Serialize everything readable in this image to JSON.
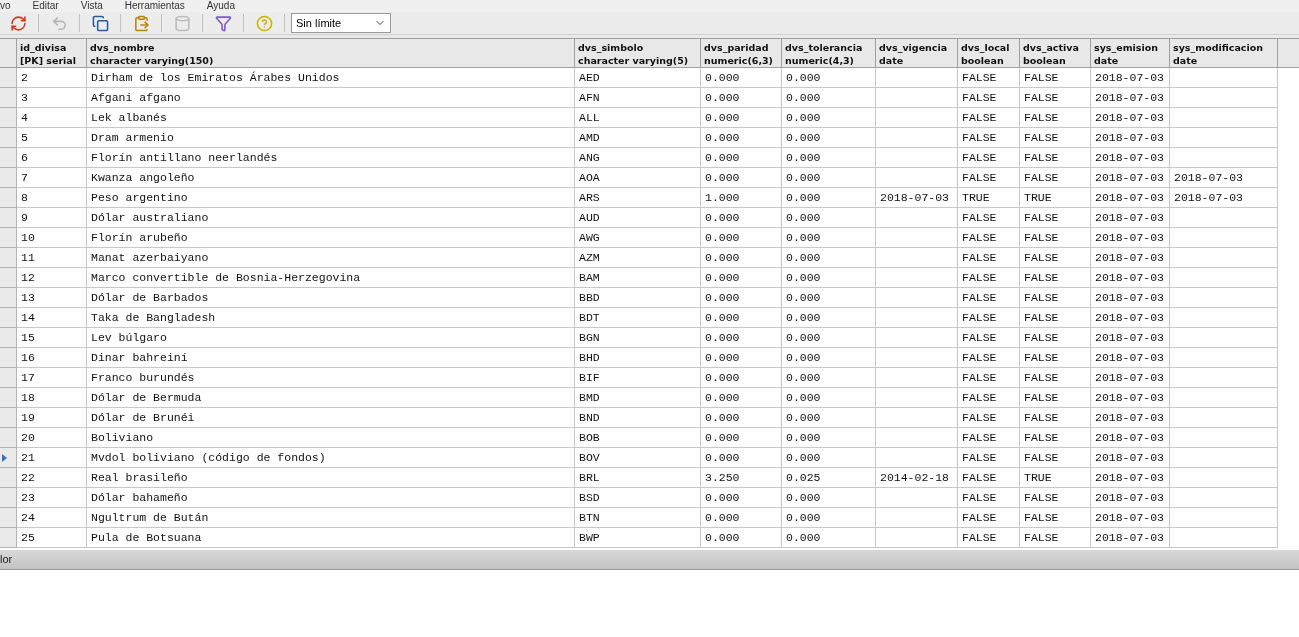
{
  "menu": [
    {
      "label": "vo"
    },
    {
      "label": "Editar"
    },
    {
      "label": "Vista"
    },
    {
      "label": "Herramientas"
    },
    {
      "label": "Ayuda"
    }
  ],
  "toolbar": {
    "buttons": [
      {
        "kind": "refresh",
        "disabled": false
      },
      {
        "kind": "undo",
        "disabled": true
      },
      {
        "kind": "copy",
        "disabled": false
      },
      {
        "kind": "paste",
        "disabled": false
      },
      {
        "kind": "delete",
        "disabled": true
      },
      {
        "kind": "filter",
        "disabled": false
      },
      {
        "kind": "help",
        "disabled": false
      }
    ],
    "limit": {
      "value": "Sin límite"
    }
  },
  "table": {
    "columns": [
      {
        "name": "id_divisa",
        "type": "[PK] serial"
      },
      {
        "name": "dvs_nombre",
        "type": "character varying(150)"
      },
      {
        "name": "dvs_simbolo",
        "type": "character varying(5)"
      },
      {
        "name": "dvs_paridad",
        "type": "numeric(6,3)"
      },
      {
        "name": "dvs_tolerancia",
        "type": "numeric(4,3)"
      },
      {
        "name": "dvs_vigencia",
        "type": "date"
      },
      {
        "name": "dvs_local",
        "type": "boolean"
      },
      {
        "name": "dvs_activa",
        "type": "boolean"
      },
      {
        "name": "sys_emision",
        "type": "date"
      },
      {
        "name": "sys_modificacion",
        "type": "date"
      }
    ],
    "rows": [
      {
        "current": false,
        "cells": [
          "2",
          "Dirham de los Emiratos Árabes Unidos",
          "AED",
          "0.000",
          "0.000",
          null,
          "FALSE",
          "FALSE",
          "2018-07-03",
          null
        ]
      },
      {
        "current": false,
        "cells": [
          "3",
          "Afgani afgano",
          "AFN",
          "0.000",
          "0.000",
          null,
          "FALSE",
          "FALSE",
          "2018-07-03",
          null
        ]
      },
      {
        "current": false,
        "cells": [
          "4",
          "Lek albanés",
          "ALL",
          "0.000",
          "0.000",
          null,
          "FALSE",
          "FALSE",
          "2018-07-03",
          null
        ]
      },
      {
        "current": false,
        "cells": [
          "5",
          "Dram armenio",
          "AMD",
          "0.000",
          "0.000",
          null,
          "FALSE",
          "FALSE",
          "2018-07-03",
          null
        ]
      },
      {
        "current": false,
        "cells": [
          "6",
          "Florín antillano neerlandés",
          "ANG",
          "0.000",
          "0.000",
          null,
          "FALSE",
          "FALSE",
          "2018-07-03",
          null
        ]
      },
      {
        "current": false,
        "cells": [
          "7",
          "Kwanza angoleño",
          "AOA",
          "0.000",
          "0.000",
          null,
          "FALSE",
          "FALSE",
          "2018-07-03",
          "2018-07-03"
        ]
      },
      {
        "current": false,
        "cells": [
          "8",
          "Peso argentino",
          "ARS",
          "1.000",
          "0.000",
          "2018-07-03",
          "TRUE",
          "TRUE",
          "2018-07-03",
          "2018-07-03"
        ]
      },
      {
        "current": false,
        "cells": [
          "9",
          "Dólar australiano",
          "AUD",
          "0.000",
          "0.000",
          null,
          "FALSE",
          "FALSE",
          "2018-07-03",
          null
        ]
      },
      {
        "current": false,
        "cells": [
          "10",
          "Florín arubeño",
          "AWG",
          "0.000",
          "0.000",
          null,
          "FALSE",
          "FALSE",
          "2018-07-03",
          null
        ]
      },
      {
        "current": false,
        "cells": [
          "11",
          "Manat azerbaiyano",
          "AZM",
          "0.000",
          "0.000",
          null,
          "FALSE",
          "FALSE",
          "2018-07-03",
          null
        ]
      },
      {
        "current": false,
        "cells": [
          "12",
          "Marco convertible de Bosnia-Herzegovina",
          "BAM",
          "0.000",
          "0.000",
          null,
          "FALSE",
          "FALSE",
          "2018-07-03",
          null
        ]
      },
      {
        "current": false,
        "cells": [
          "13",
          "Dólar de Barbados",
          "BBD",
          "0.000",
          "0.000",
          null,
          "FALSE",
          "FALSE",
          "2018-07-03",
          null
        ]
      },
      {
        "current": false,
        "cells": [
          "14",
          "Taka de Bangladesh",
          "BDT",
          "0.000",
          "0.000",
          null,
          "FALSE",
          "FALSE",
          "2018-07-03",
          null
        ]
      },
      {
        "current": false,
        "cells": [
          "15",
          "Lev búlgaro",
          "BGN",
          "0.000",
          "0.000",
          null,
          "FALSE",
          "FALSE",
          "2018-07-03",
          null
        ]
      },
      {
        "current": false,
        "cells": [
          "16",
          "Dinar bahreiní",
          "BHD",
          "0.000",
          "0.000",
          null,
          "FALSE",
          "FALSE",
          "2018-07-03",
          null
        ]
      },
      {
        "current": false,
        "cells": [
          "17",
          "Franco burundés",
          "BIF",
          "0.000",
          "0.000",
          null,
          "FALSE",
          "FALSE",
          "2018-07-03",
          null
        ]
      },
      {
        "current": false,
        "cells": [
          "18",
          "Dólar de Bermuda",
          "BMD",
          "0.000",
          "0.000",
          null,
          "FALSE",
          "FALSE",
          "2018-07-03",
          null
        ]
      },
      {
        "current": false,
        "cells": [
          "19",
          "Dólar de Brunéi",
          "BND",
          "0.000",
          "0.000",
          null,
          "FALSE",
          "FALSE",
          "2018-07-03",
          null
        ]
      },
      {
        "current": false,
        "cells": [
          "20",
          "Boliviano",
          "BOB",
          "0.000",
          "0.000",
          null,
          "FALSE",
          "FALSE",
          "2018-07-03",
          null
        ]
      },
      {
        "current": true,
        "cells": [
          "21",
          "Mvdol boliviano (código de fondos)",
          "BOV",
          "0.000",
          "0.000",
          null,
          "FALSE",
          "FALSE",
          "2018-07-03",
          null
        ]
      },
      {
        "current": false,
        "cells": [
          "22",
          "Real brasileño",
          "BRL",
          "3.250",
          "0.025",
          "2014-02-18",
          "FALSE",
          "TRUE",
          "2018-07-03",
          null
        ]
      },
      {
        "current": false,
        "cells": [
          "23",
          "Dólar bahameño",
          "BSD",
          "0.000",
          "0.000",
          null,
          "FALSE",
          "FALSE",
          "2018-07-03",
          null
        ]
      },
      {
        "current": false,
        "cells": [
          "24",
          "Ngultrum de Bután",
          "BTN",
          "0.000",
          "0.000",
          null,
          "FALSE",
          "FALSE",
          "2018-07-03",
          null
        ]
      },
      {
        "current": false,
        "cells": [
          "25",
          "Pula de Botsuana",
          "BWP",
          "0.000",
          "0.000",
          null,
          "FALSE",
          "FALSE",
          "2018-07-03",
          null
        ]
      }
    ]
  },
  "status_bar": {
    "text": "lor"
  }
}
